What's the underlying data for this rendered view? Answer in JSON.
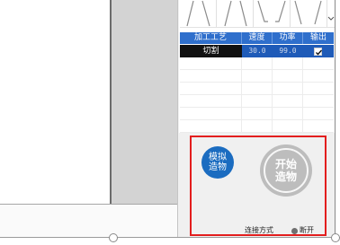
{
  "shape_palette": {
    "shapes": [
      "peak-shape-icon",
      "peak-shape-icon",
      "stepped-valley-shape-icon",
      "valley-shape-icon"
    ],
    "more_icon": "chevron-down-icon"
  },
  "process_table": {
    "headers": [
      "加工工艺",
      "速度",
      "功率",
      "输出"
    ],
    "rows": [
      {
        "process": "切割",
        "speed": "30.0",
        "power": "99.0",
        "output": true
      }
    ]
  },
  "simulate_button": {
    "lines": [
      "模拟",
      "造物"
    ]
  },
  "start_button": {
    "lines": [
      "开始",
      "造物"
    ]
  },
  "connection": {
    "label": "连接方式",
    "status": "断开",
    "status_icon": "status-dot-icon"
  },
  "colors": {
    "table_header": "#2f6fcc",
    "selected_row": "#1f5bb8",
    "selected_cell": "#111111",
    "highlight_frame": "#e31e1e",
    "simulate_button": "#1b6cc0",
    "start_button": "#bdbdbd",
    "status_disconnected": "#6f6f6f"
  }
}
